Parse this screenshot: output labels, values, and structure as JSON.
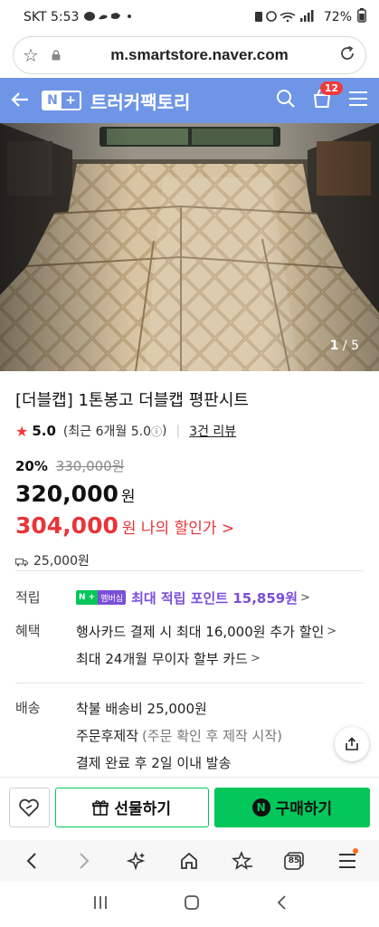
{
  "status_bar": {
    "carrier_time": "SKT 5:53",
    "battery": "72%"
  },
  "url_bar": {
    "url": "m.smartstore.naver.com"
  },
  "header": {
    "logo_n": "N",
    "logo_plus": "+",
    "store_name": "트러커팩토리",
    "cart_count": "12"
  },
  "gallery": {
    "current": "1",
    "total": "/ 5"
  },
  "product": {
    "title": "[더블캡] 1톤봉고 더블캡 평판시트",
    "rating_score": "5.0",
    "rating_recent": "(최근 6개월 5.0",
    "rating_info_icon": "ⓘ",
    "rating_recent_close": ")",
    "review_link": "3건 리뷰",
    "discount_pct": "20%",
    "original_price": "330,000원",
    "price": "320,000",
    "price_unit": "원",
    "my_price": "304,000",
    "my_price_label": "원 나의 할인가 >",
    "shipping_fee": "25,000원"
  },
  "points": {
    "label": "적립",
    "badge_np": "N +",
    "badge_membership": "멤버십",
    "text": "최대 적립 포인트 15,859원",
    "chevron": ">"
  },
  "benefits": {
    "label": "혜택",
    "line1": "행사카드 결제 시 최대 16,000원 추가 할인",
    "line2": "최대 24개월 무이자 할부 카드",
    "chevron": ">"
  },
  "delivery": {
    "label": "배송",
    "line1": "착불 배송비 25,000원",
    "line2_main": "주문후제작",
    "line2_note": "(주문 확인 후 제작 시작)",
    "line3": "결제 완료 후 2일 이내 발송"
  },
  "actions": {
    "gift_label": "선물하기",
    "buy_label": "구매하기",
    "buy_n": "N"
  },
  "browser_nav": {
    "tabs_count": "85"
  },
  "colors": {
    "header_bg": "#6f96e6",
    "naver_green": "#03c75a",
    "sale_red": "#e8343a",
    "membership_purple": "#7b4fd8"
  }
}
